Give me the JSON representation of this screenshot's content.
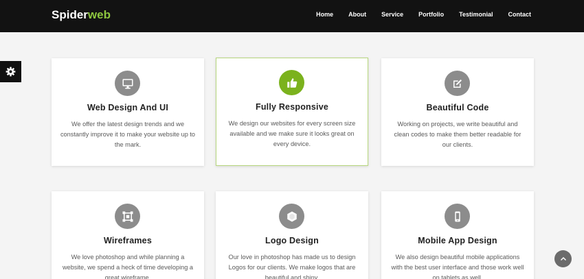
{
  "brand": {
    "part1": "Spider",
    "part2": "web",
    "accent_color": "#8dc63f"
  },
  "nav": {
    "items": [
      "Home",
      "About",
      "Service",
      "Portfolio",
      "Testimonial",
      "Contact"
    ]
  },
  "settings": {
    "icon": "gear-icon"
  },
  "services": [
    {
      "icon": "monitor-icon",
      "title": "Web Design And UI",
      "description": "We offer the latest design trends and we constantly improve it to make your website up to the mark."
    },
    {
      "icon": "thumbs-up-icon",
      "title": "Fully Responsive",
      "description": "We design our websites for every screen size available and we make sure it looks great on every device."
    },
    {
      "icon": "edit-icon",
      "title": "Beautiful Code",
      "description": "Working on projects, we write beautiful and clean codes to make them better readable for our clients."
    },
    {
      "icon": "wireframe-icon",
      "title": "Wireframes",
      "description": "We love photoshop and while planning a website, we spend a heck of time developing a great wireframe."
    },
    {
      "icon": "hexagon-icon",
      "title": "Logo Design",
      "description": "Our love in photoshop has made us to design Logos for our clients. We make logos that are beautiful and shiny."
    },
    {
      "icon": "mobile-icon",
      "title": "Mobile App Design",
      "description": "We also design beautiful mobile applications with the best user interface and those work well on tablets as well."
    }
  ],
  "scroll_top": {
    "icon": "chevron-up-icon"
  }
}
